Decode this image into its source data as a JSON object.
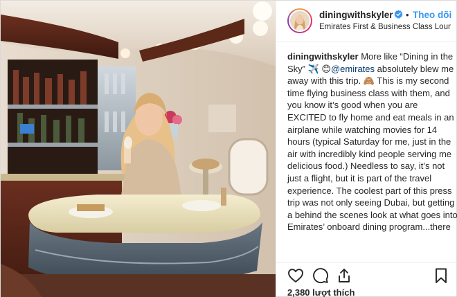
{
  "post": {
    "username": "diningwithskyler",
    "follow_label": "Theo dõi",
    "location": "Emirates First & Business Class Lounge @ ...",
    "caption": {
      "username": "diningwithskyler",
      "part1": "More like “Dining in the Sky” ✈️ 😊",
      "mention": "@emirates",
      "part2": "absolutely blew me away with this trip. 🙈 This is my second time flying business class with them, and you know it’s good when you are EXCITED to fly home and eat meals in an airplane while watching movies for 14 hours (typical Saturday for me, just in the air with incredibly kind people serving me delicious food.) Needless to say, it’s not just a flight, but it is part of the travel experience. The coolest part of this press trip was not only seeing Dubai, but getting a behind the scenes look at what goes into Emirates’ onboard dining program...there are so many moving parts that go into creating delicious food to be consumed in the sky. Also, the rumor of additives in airplane food is NOT true. All deets on this will be on my story! I genuinely hope I can enjoy"
    },
    "likes_label": "2,380 lượt thích"
  },
  "icons": {
    "verified": "verified-badge-icon",
    "like": "heart-icon",
    "comment": "comment-bubble-icon",
    "share": "share-icon",
    "save": "bookmark-icon"
  },
  "colors": {
    "link": "#3897f0",
    "mention": "#003569",
    "text": "#262626",
    "border": "#efefef"
  }
}
